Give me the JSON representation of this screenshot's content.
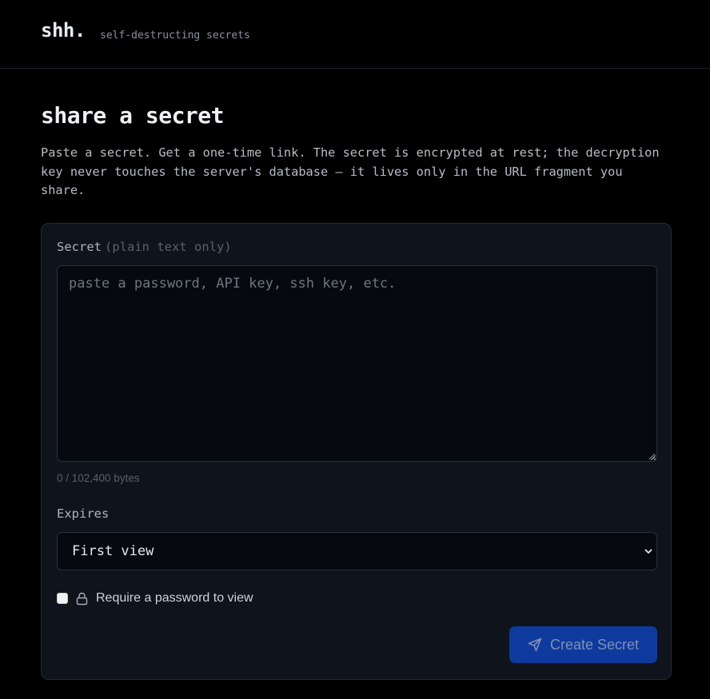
{
  "header": {
    "logo": "shh.",
    "tagline": "self-destructing secrets"
  },
  "main": {
    "title": "share a secret",
    "intro": "Paste a secret. Get a one-time link. The secret is encrypted at rest; the decryption key never touches the server's database — it lives only in the URL fragment you share."
  },
  "form": {
    "secret_label": "Secret",
    "secret_hint": "(plain text only)",
    "secret_value": "",
    "secret_placeholder": "paste a password, API key, ssh key, etc.",
    "byte_count": "0 / 102,400 bytes",
    "expires_label": "Expires",
    "expires_value": "First view",
    "password_checked": false,
    "password_label": "Require a password to view",
    "submit_label": "Create Secret"
  },
  "icons": {
    "lock": "lock-icon",
    "send": "send-icon",
    "chevron": "chevron-down-icon"
  },
  "colors": {
    "background": "#000000",
    "card": "#0e131c",
    "accent": "#0f3a9d"
  }
}
